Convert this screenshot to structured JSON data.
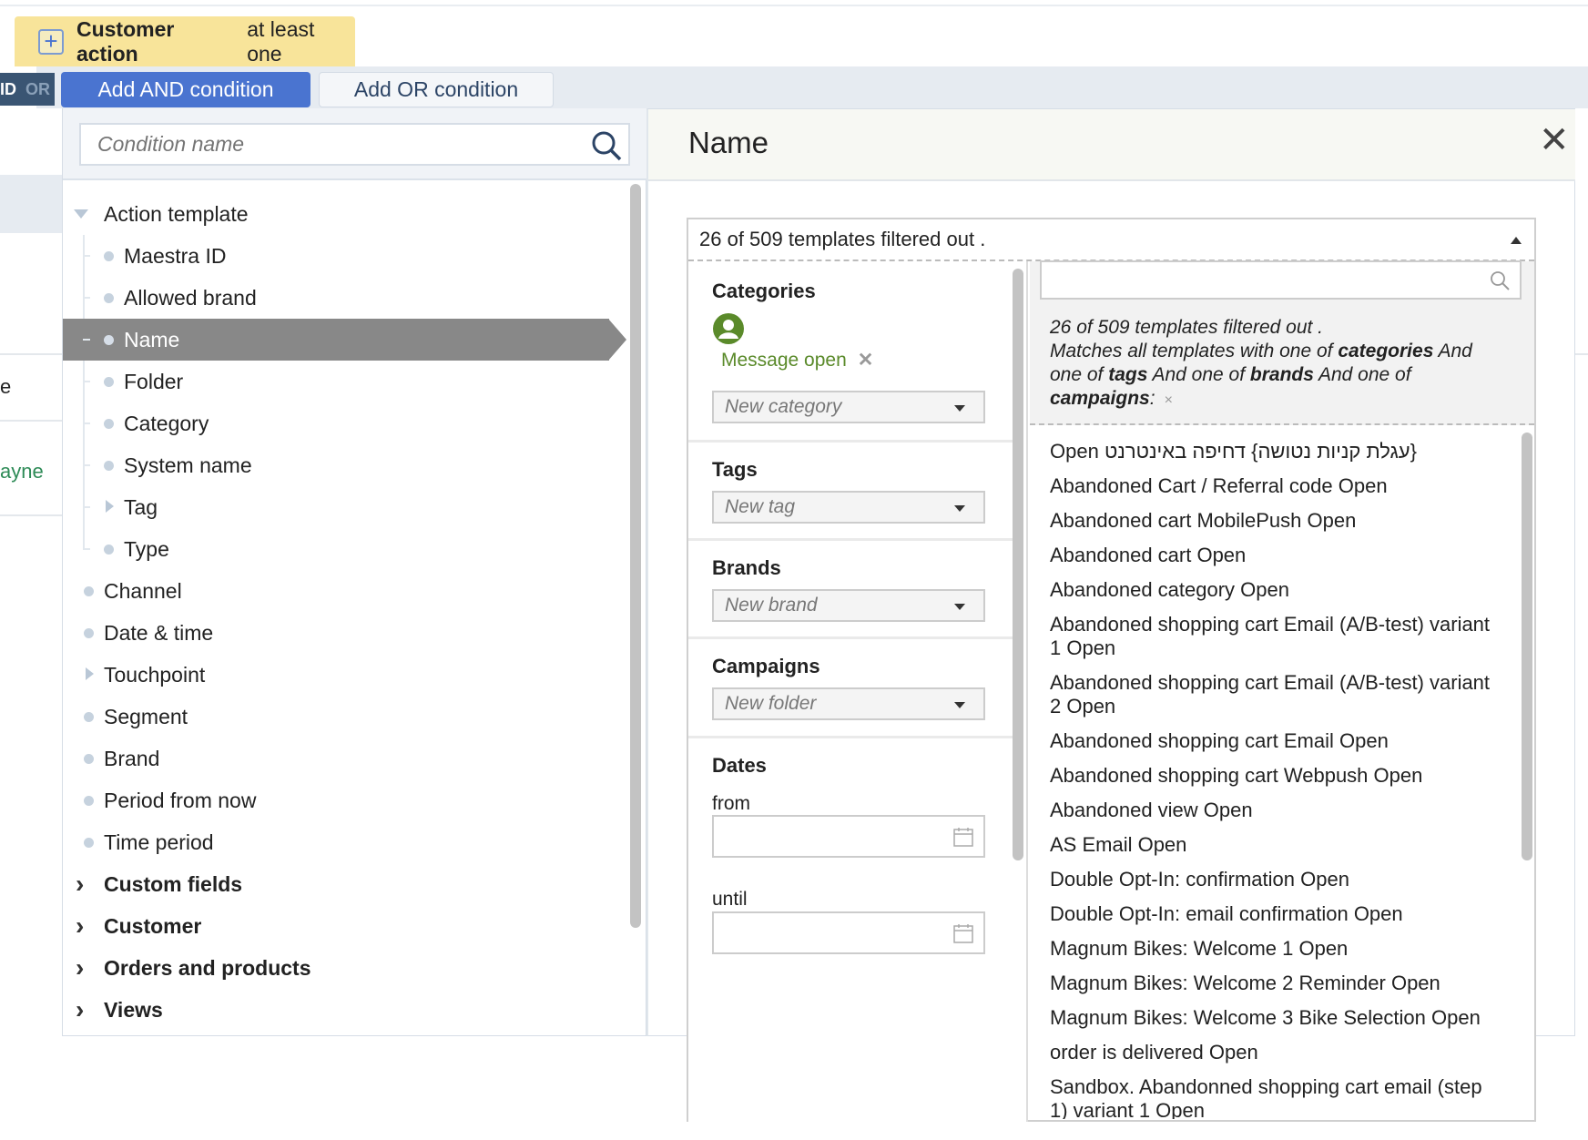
{
  "header": {
    "card_bold": "Customer action",
    "card_rest": "at least one",
    "and_label": "ID",
    "or_label": "OR",
    "add_and": "Add AND condition",
    "add_or": "Add OR condition"
  },
  "background": {
    "fragment_1": "e",
    "fragment_2": "ayne"
  },
  "left": {
    "search_placeholder": "Condition name",
    "tree": [
      {
        "label": "Action template",
        "level": 0,
        "kind": "expanded"
      },
      {
        "label": "Maestra ID",
        "level": 1,
        "kind": "leaf"
      },
      {
        "label": "Allowed brand",
        "level": 1,
        "kind": "leaf"
      },
      {
        "label": "Name",
        "level": 1,
        "kind": "leaf",
        "selected": true
      },
      {
        "label": "Folder",
        "level": 1,
        "kind": "leaf"
      },
      {
        "label": "Category",
        "level": 1,
        "kind": "leaf"
      },
      {
        "label": "System name",
        "level": 1,
        "kind": "leaf"
      },
      {
        "label": "Tag",
        "level": 1,
        "kind": "collapsed"
      },
      {
        "label": "Type",
        "level": 1,
        "kind": "leaf"
      },
      {
        "label": "Channel",
        "level": 0,
        "kind": "leaf"
      },
      {
        "label": "Date & time",
        "level": 0,
        "kind": "leaf"
      },
      {
        "label": "Touchpoint",
        "level": 0,
        "kind": "collapsed"
      },
      {
        "label": "Segment",
        "level": 0,
        "kind": "leaf"
      },
      {
        "label": "Brand",
        "level": 0,
        "kind": "leaf"
      },
      {
        "label": "Period from now",
        "level": 0,
        "kind": "leaf"
      },
      {
        "label": "Time period",
        "level": 0,
        "kind": "leaf"
      },
      {
        "label": "Custom fields",
        "level": 0,
        "kind": "group"
      },
      {
        "label": "Customer",
        "level": 0,
        "kind": "group"
      },
      {
        "label": "Orders and products",
        "level": 0,
        "kind": "group"
      },
      {
        "label": "Views",
        "level": 0,
        "kind": "group"
      }
    ]
  },
  "right": {
    "title": "Name",
    "filter_header": "26 of 509 templates filtered out .",
    "categories_label": "Categories",
    "category_chip": "Message open",
    "category_placeholder": "New category",
    "tags_label": "Tags",
    "tag_placeholder": "New tag",
    "brands_label": "Brands",
    "brand_placeholder": "New brand",
    "campaigns_label": "Campaigns",
    "campaign_placeholder": "New folder",
    "dates_label": "Dates",
    "from_label": "from",
    "until_label": "until",
    "summary": {
      "line1": "26 of 509 templates filtered out .",
      "p1": "Matches all templates with one of ",
      "b1": "categories",
      "p2": " And one of ",
      "b2": "tags",
      "p3": " And one of ",
      "b3": "brands",
      "p4": " And one of ",
      "b4": "campaigns",
      "p5": ":",
      "clear": "×"
    },
    "templates": [
      "{עגלת קניות נטושה} דחיפה באינטרנט Open",
      "Abandoned Cart / Referral code Open",
      "Abandoned cart MobilePush Open",
      "Abandoned cart Open",
      "Abandoned category Open",
      "Abandoned shopping cart Email (A/B-test) variant 1 Open",
      "Abandoned shopping cart Email (A/B-test) variant 2 Open",
      "Abandoned shopping cart Email Open",
      "Abandoned shopping cart Webpush Open",
      "Abandoned view Open",
      "AS Email Open",
      "Double Opt-In: confirmation Open",
      "Double Opt-In: email confirmation Open",
      "Magnum Bikes: Welcome 1 Open",
      "Magnum Bikes: Welcome 2 Reminder Open",
      "Magnum Bikes: Welcome 3 Bike Selection Open",
      "order is delivered Open",
      "Sandbox. Abandonned shopping cart email (step 1) variant 1 Open"
    ]
  },
  "colors": {
    "card_bg": "#f8e49a",
    "and_button": "#4a74d0",
    "selected_row": "#888888",
    "chip_green": "#5a8a2a",
    "bg_link_green": "#2e8b57"
  }
}
